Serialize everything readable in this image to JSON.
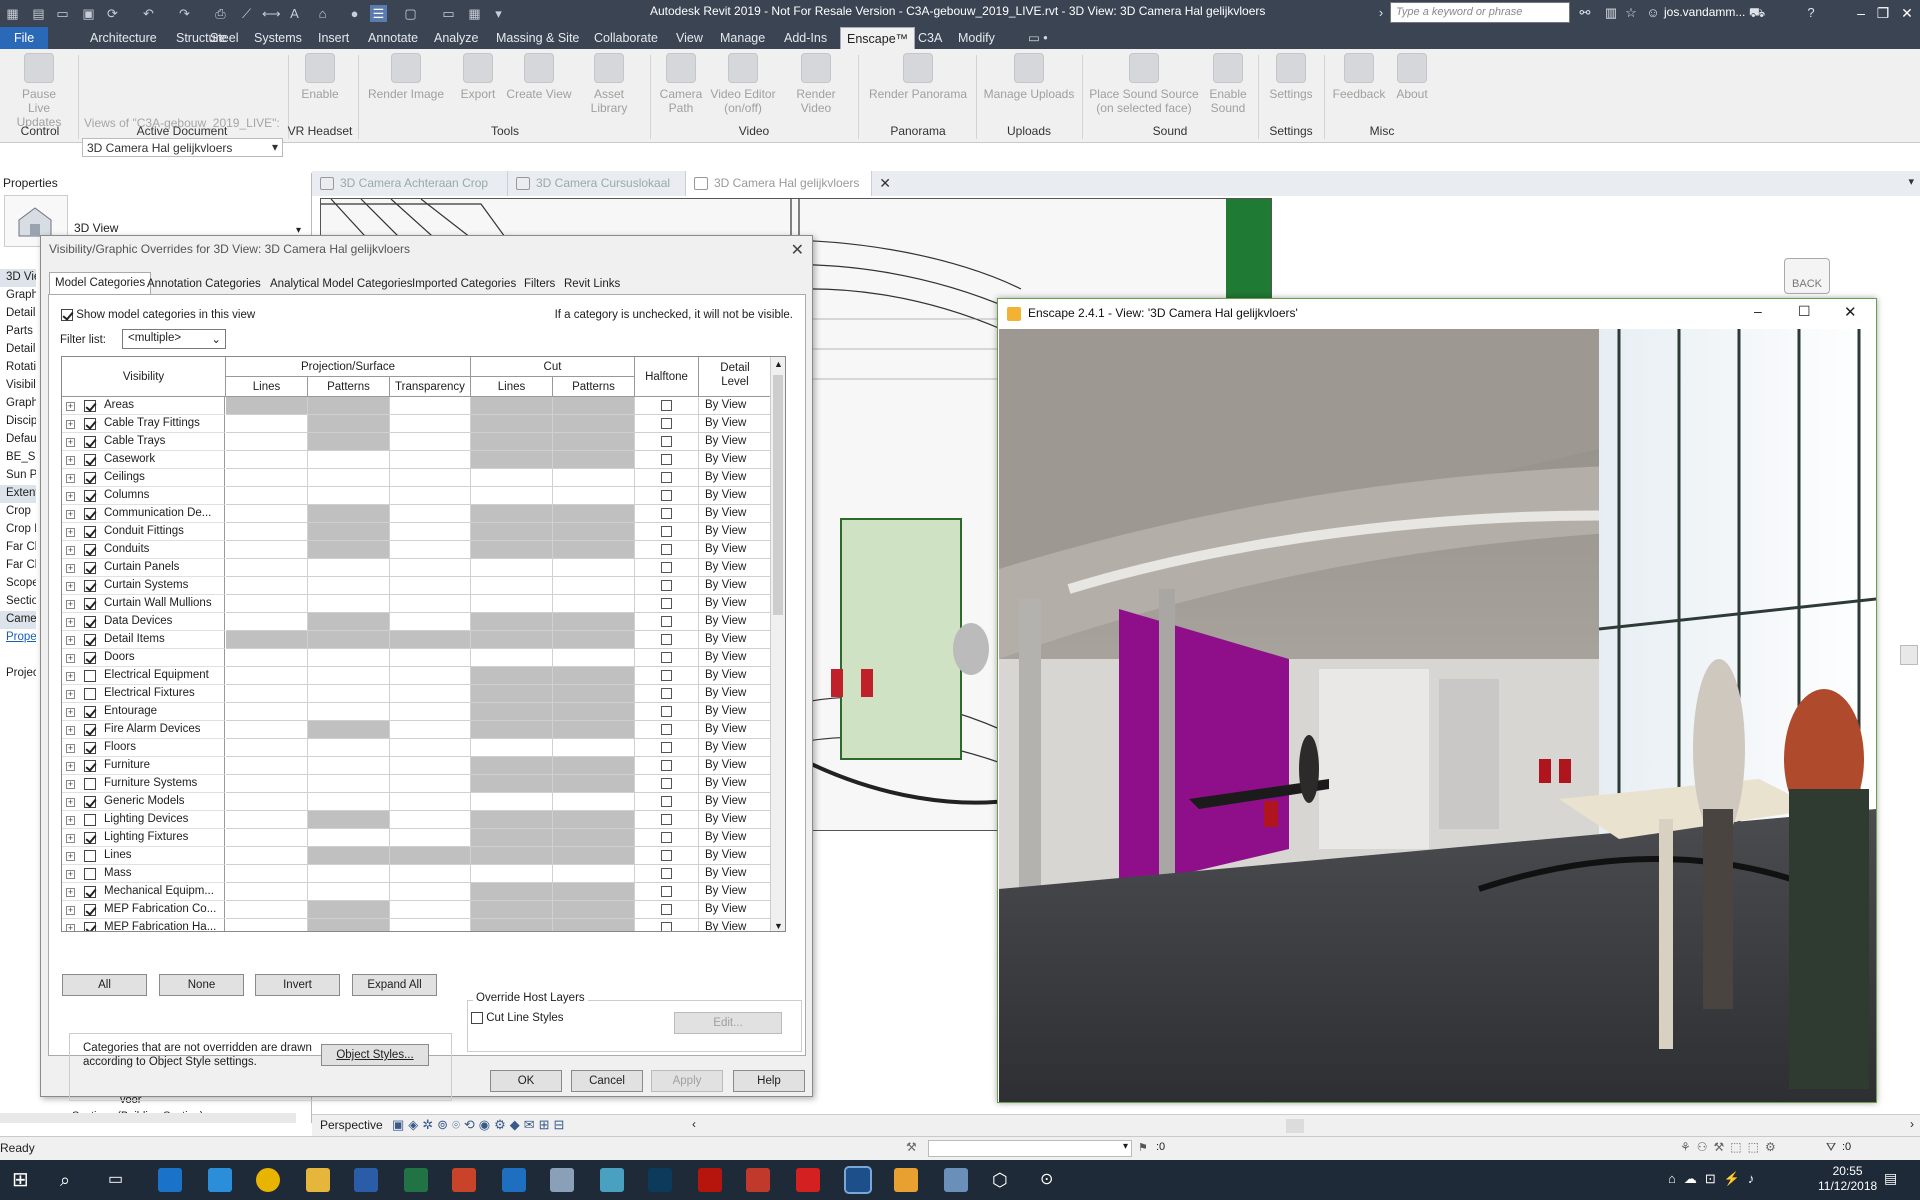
{
  "app": {
    "title": "Autodesk Revit 2019 - Not For Resale Version - C3A-gebouw_2019_LIVE.rvt - 3D View: 3D Camera Hal gelijkvloers",
    "search_placeholder": "Type a keyword or phrase",
    "user": "jos.vandamm...",
    "accent": "#2a69b8"
  },
  "menu": {
    "tabs": [
      "File",
      "Architecture",
      "Structure",
      "Steel",
      "Systems",
      "Insert",
      "Annotate",
      "Analyze",
      "Massing & Site",
      "Collaborate",
      "View",
      "Manage",
      "Add-Ins",
      "Enscape™",
      "C3A",
      "Modify"
    ],
    "active": "Enscape™"
  },
  "ribbon": {
    "buttons": {
      "pause": "Pause\nLive Updates",
      "enable": "Enable",
      "render_image": "Render Image",
      "export": "Export",
      "create_view": "Create View",
      "asset_library": "Asset Library",
      "camera_path": "Camera\nPath",
      "video_editor": "Video Editor\n(on/off)",
      "render_video": "Render Video",
      "render_panorama": "Render Panorama",
      "manage_uploads": "Manage Uploads",
      "place_sound": "Place Sound Source\n(on selected face)",
      "enable_sound": "Enable\nSound",
      "settings": "Settings",
      "feedback": "Feedback",
      "about": "About"
    },
    "views_of": "Views of \"C3A-gebouw_2019_LIVE\":",
    "view_select": "3D Camera Hal gelijkvloers",
    "groups": {
      "control": "Control",
      "active_document": "Active Document",
      "vr_headset": "VR Headset",
      "tools": "Tools",
      "video": "Video",
      "panorama": "Panorama",
      "uploads": "Uploads",
      "sound": "Sound",
      "settings": "Settings",
      "misc": "Misc"
    }
  },
  "viewtabs": [
    "3D Camera Achteraan Crop",
    "3D Camera Cursuslokaal",
    "3D Camera Hal gelijkvloers"
  ],
  "properties": {
    "title": "Properties",
    "type": "3D View",
    "rows": [
      "3D Vie",
      "Graphi",
      "Detail",
      "Parts V",
      "Detail",
      "Rotati",
      "Visibil",
      "Graph",
      "Discip",
      "Defau",
      "BE_Su",
      "Sun P",
      "Extents",
      "Crop",
      "Crop I",
      "Far Cl",
      "Far Cl",
      "Scope",
      "Sectio",
      "Camer",
      "Proper",
      "",
      "Project"
    ],
    "tree_item": "voor",
    "tree_section": "Sections (Building Section)"
  },
  "view": {
    "back": "BACK"
  },
  "vg": {
    "title": "Visibility/Graphic Overrides for 3D View: 3D Camera Hal gelijkvloers",
    "tabs": [
      "Model Categories",
      "Annotation Categories",
      "Analytical Model Categories",
      "Imported Categories",
      "Filters",
      "Revit Links"
    ],
    "show_model": "Show model categories in this view",
    "unchecked_note": "If a category is unchecked, it will not be visible.",
    "filter_label": "Filter list:",
    "filter_value": "<multiple>",
    "headers": {
      "visibility": "Visibility",
      "projection": "Projection/Surface",
      "cut": "Cut",
      "lines": "Lines",
      "patterns": "Patterns",
      "transparency": "Transparency",
      "halftone": "Halftone",
      "detail_level": "Detail Level"
    },
    "detail_value": "By View",
    "rows": [
      {
        "name": "Areas",
        "on": true,
        "g": [
          1,
          1,
          0,
          1,
          1
        ]
      },
      {
        "name": "Cable Tray Fittings",
        "on": true,
        "g": [
          0,
          1,
          0,
          1,
          1
        ]
      },
      {
        "name": "Cable Trays",
        "on": true,
        "g": [
          0,
          1,
          0,
          1,
          1
        ]
      },
      {
        "name": "Casework",
        "on": true,
        "g": [
          0,
          0,
          0,
          1,
          1
        ]
      },
      {
        "name": "Ceilings",
        "on": true,
        "g": [
          0,
          0,
          0,
          0,
          0
        ]
      },
      {
        "name": "Columns",
        "on": true,
        "g": [
          0,
          0,
          0,
          0,
          0
        ]
      },
      {
        "name": "Communication De...",
        "on": true,
        "g": [
          0,
          1,
          0,
          1,
          1
        ]
      },
      {
        "name": "Conduit Fittings",
        "on": true,
        "g": [
          0,
          1,
          0,
          1,
          1
        ]
      },
      {
        "name": "Conduits",
        "on": true,
        "g": [
          0,
          1,
          0,
          1,
          1
        ]
      },
      {
        "name": "Curtain Panels",
        "on": true,
        "g": [
          0,
          0,
          0,
          0,
          0
        ]
      },
      {
        "name": "Curtain Systems",
        "on": true,
        "g": [
          0,
          0,
          0,
          0,
          0
        ]
      },
      {
        "name": "Curtain Wall Mullions",
        "on": true,
        "g": [
          0,
          0,
          0,
          0,
          0
        ]
      },
      {
        "name": "Data Devices",
        "on": true,
        "g": [
          0,
          1,
          0,
          1,
          1
        ]
      },
      {
        "name": "Detail Items",
        "on": true,
        "g": [
          1,
          1,
          1,
          1,
          1
        ]
      },
      {
        "name": "Doors",
        "on": true,
        "g": [
          0,
          0,
          0,
          0,
          0
        ]
      },
      {
        "name": "Electrical Equipment",
        "on": false,
        "g": [
          0,
          0,
          0,
          1,
          1
        ]
      },
      {
        "name": "Electrical Fixtures",
        "on": false,
        "g": [
          0,
          0,
          0,
          1,
          1
        ]
      },
      {
        "name": "Entourage",
        "on": true,
        "g": [
          0,
          0,
          0,
          1,
          1
        ]
      },
      {
        "name": "Fire Alarm Devices",
        "on": true,
        "g": [
          0,
          1,
          0,
          1,
          1
        ]
      },
      {
        "name": "Floors",
        "on": true,
        "g": [
          0,
          0,
          0,
          0,
          0
        ]
      },
      {
        "name": "Furniture",
        "on": true,
        "g": [
          0,
          0,
          0,
          1,
          1
        ]
      },
      {
        "name": "Furniture Systems",
        "on": false,
        "g": [
          0,
          0,
          0,
          1,
          1
        ]
      },
      {
        "name": "Generic Models",
        "on": true,
        "g": [
          0,
          0,
          0,
          0,
          0
        ]
      },
      {
        "name": "Lighting Devices",
        "on": false,
        "g": [
          0,
          1,
          0,
          1,
          1
        ]
      },
      {
        "name": "Lighting Fixtures",
        "on": true,
        "g": [
          0,
          0,
          0,
          1,
          1
        ]
      },
      {
        "name": "Lines",
        "on": false,
        "g": [
          0,
          1,
          1,
          1,
          1
        ]
      },
      {
        "name": "Mass",
        "on": false,
        "g": [
          0,
          0,
          0,
          0,
          0
        ]
      },
      {
        "name": "Mechanical Equipm...",
        "on": true,
        "g": [
          0,
          0,
          0,
          1,
          1
        ]
      },
      {
        "name": "MEP Fabrication Co...",
        "on": true,
        "g": [
          0,
          1,
          0,
          1,
          1
        ]
      },
      {
        "name": "MEP Fabrication Ha...",
        "on": true,
        "g": [
          0,
          1,
          0,
          1,
          1
        ]
      }
    ],
    "buttons": {
      "all": "All",
      "none": "None",
      "invert": "Invert",
      "expand_all": "Expand All",
      "object_styles": "Object Styles...",
      "edit": "Edit...",
      "ok": "OK",
      "cancel": "Cancel",
      "apply": "Apply",
      "help": "Help"
    },
    "override_host": "Override Host Layers",
    "cut_line_styles": "Cut Line Styles",
    "note": "Categories that are not overridden are drawn according to Object Style settings."
  },
  "enscape": {
    "title": "Enscape 2.4.1 - View: '3D Camera Hal gelijkvloers'",
    "accent": "#a1089d"
  },
  "viewctl": {
    "mode": "Perspective"
  },
  "status": {
    "text": "Ready",
    "zero": ":0",
    "zero2": ":0"
  },
  "clock": {
    "time": "20:55",
    "date": "11/12/2018"
  }
}
